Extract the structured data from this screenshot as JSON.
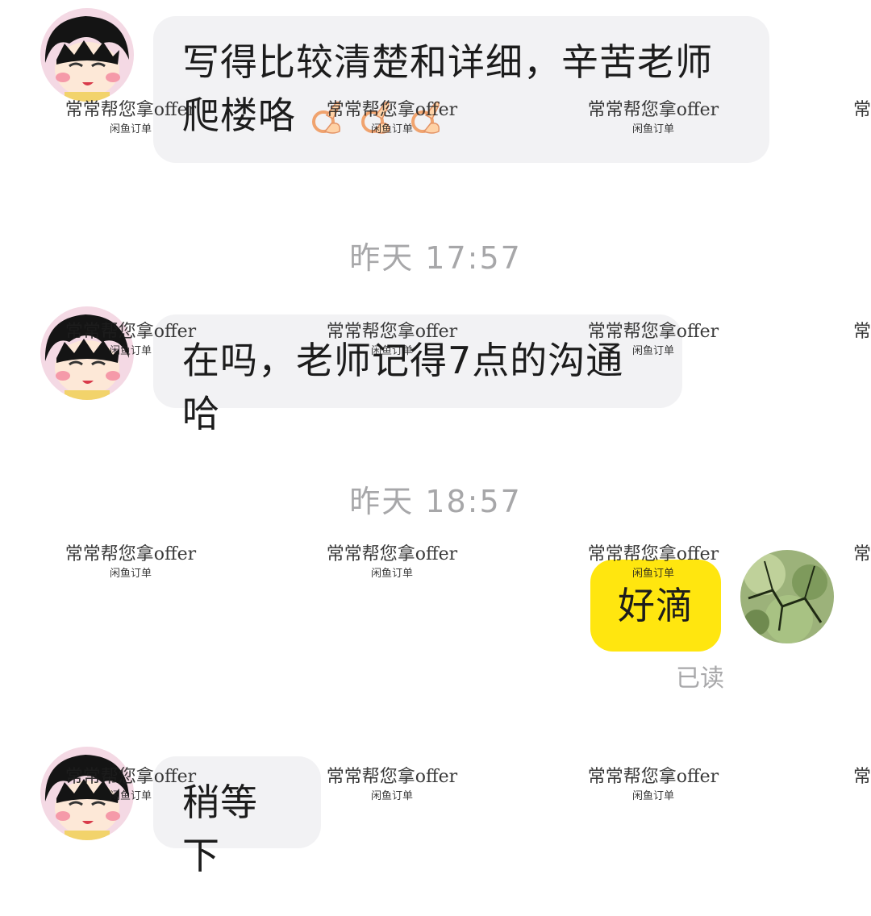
{
  "messages": [
    {
      "sender": "other",
      "text_line1": "写得比较清楚和详细，辛苦老师",
      "text_line2": "爬楼咯"
    },
    {
      "sender": "other",
      "text": "在吗，老师记得7点的沟通哈"
    },
    {
      "sender": "me",
      "text": "好滴",
      "read_status": "已读"
    },
    {
      "sender": "other",
      "text": "稍等下"
    }
  ],
  "timestamps": [
    "昨天 17:57",
    "昨天 18:57"
  ],
  "watermark": {
    "main": "常常帮您拿offer",
    "sub": "闲鱼订单",
    "edge": "常"
  },
  "icons": {
    "other_avatar": "cartoon-girl-avatar",
    "self_avatar": "green-moss-avatar",
    "emoji": "ok-hand-emoji"
  },
  "colors": {
    "outgoing_bubble": "#ffe60f",
    "incoming_bubble": "#f2f2f4",
    "timestamp_text": "#a7a7a9"
  }
}
